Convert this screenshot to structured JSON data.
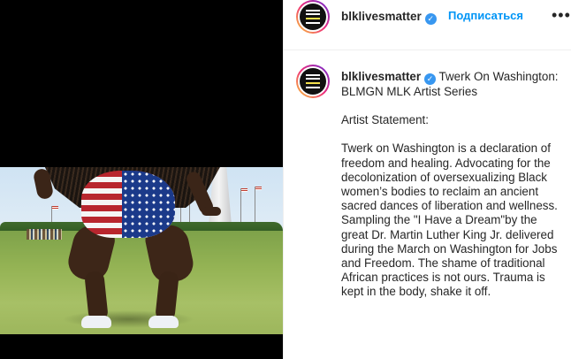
{
  "post": {
    "username": "blklivesmatter",
    "verified_icon": "verified-badge-icon",
    "follow_label": "Подписаться",
    "more_icon": "more-options-icon",
    "more_glyph": "•••"
  },
  "caption": {
    "username": "blklivesmatter",
    "title": "Twerk On Washington: BLMGN MLK Artist Series",
    "heading": "Artist Statement:",
    "body": "Twerk on Washington is a declaration of freedom and healing. Advocating for the decolonization of oversexualizing Black women’s bodies to reclaim an ancient sacred dances of liberation and wellness. Sampling the \"I Have a Dream\"by the great Dr. Martin Luther King Jr. delivered during the March on Washington for Jobs and Freedom. The shame of traditional African practices is not ours. Trauma is kept in the body, shake it off."
  },
  "colors": {
    "accent_blue": "#0095f6",
    "verified_blue": "#3897f0",
    "text": "#262626"
  }
}
